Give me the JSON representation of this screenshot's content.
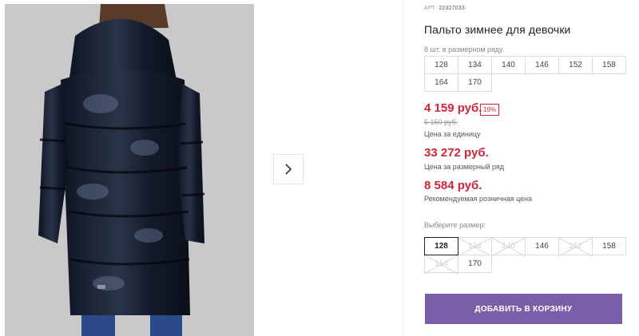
{
  "gallery": {
    "next_icon": "chevron-right-icon",
    "bg_color": "#c9c9c9"
  },
  "product": {
    "article_label": "АРТ:",
    "article_number": "22327033",
    "title": "Пальто зимнее для девочки",
    "sizes_note": "8 шт. в размерном ряду",
    "size_row": [
      "128",
      "134",
      "140",
      "146",
      "152",
      "158",
      "164",
      "170"
    ]
  },
  "prices": {
    "unit_price": "4 159 руб.",
    "discount": "19%",
    "old_price": "5 150 руб.",
    "unit_label": "Цена за единицу",
    "series_price": "33 272 руб.",
    "series_label": "Цена за размерный ряд",
    "retail_price": "8 584 руб.",
    "retail_label": "Рекомендуемая розничная цена",
    "accent_color": "#d0263a"
  },
  "size_selector": {
    "label": "Выберите размер:",
    "options": [
      {
        "size": "128",
        "state": "selected"
      },
      {
        "size": "134",
        "state": "disabled"
      },
      {
        "size": "140",
        "state": "disabled"
      },
      {
        "size": "146",
        "state": "available"
      },
      {
        "size": "152",
        "state": "disabled"
      },
      {
        "size": "158",
        "state": "available"
      },
      {
        "size": "164",
        "state": "disabled"
      },
      {
        "size": "170",
        "state": "available"
      }
    ]
  },
  "cart": {
    "button_label": "ДОБАВИТЬ В КОРЗИНУ",
    "button_color": "#7a5ea8"
  }
}
